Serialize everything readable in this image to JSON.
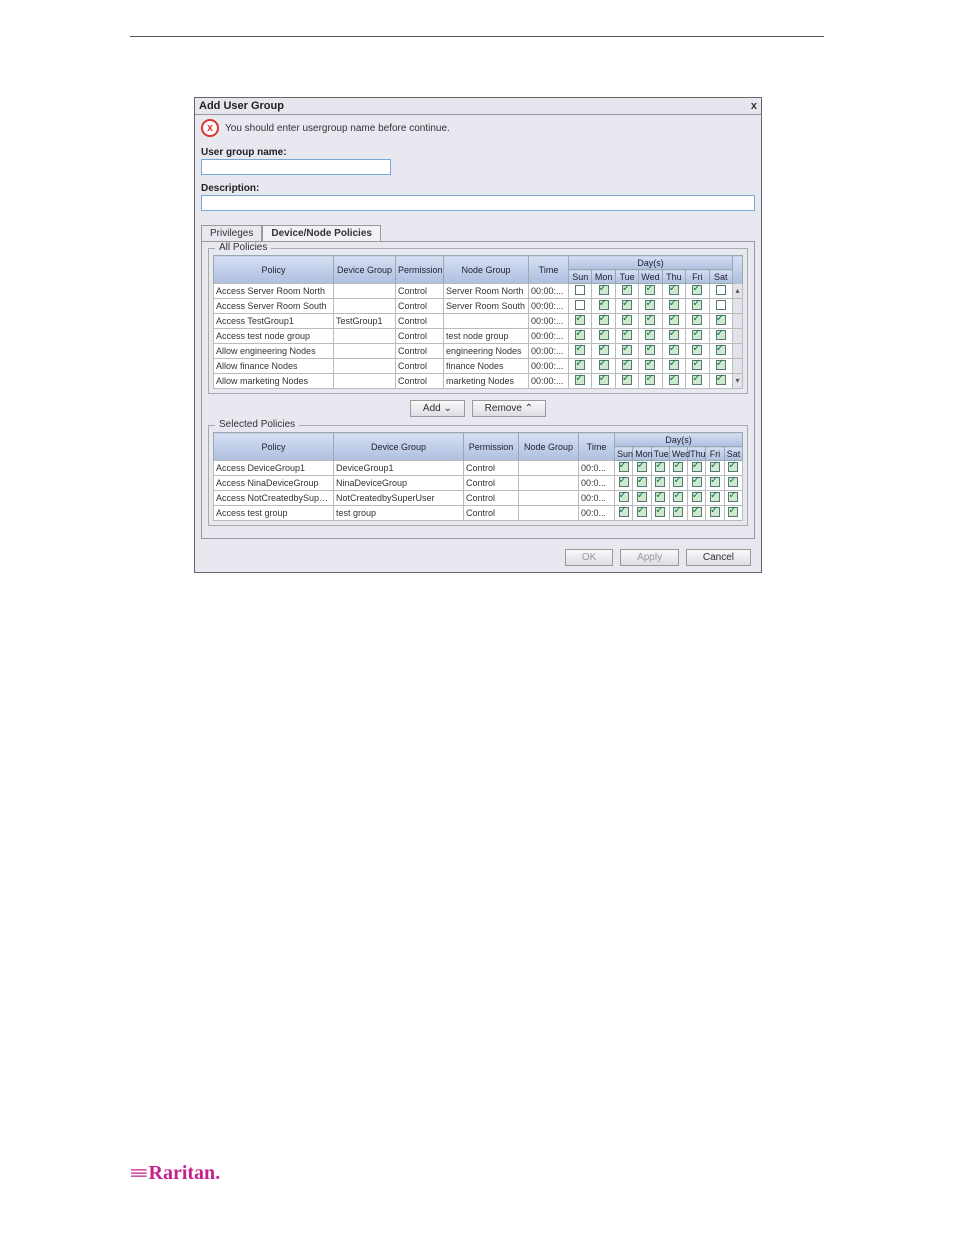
{
  "dialog": {
    "title": "Add User Group",
    "close": "x",
    "alert": "You should enter usergroup name before continue.",
    "groupNameLabel": "User group name:",
    "descriptionLabel": "Description:"
  },
  "tabs": {
    "privileges": "Privileges",
    "policies": "Device/Node Policies"
  },
  "fieldsets": {
    "all": "All Policies",
    "selected": "Selected Policies"
  },
  "headers": {
    "policy": "Policy",
    "deviceGroup": "Device Group",
    "permission": "Permission",
    "nodeGroup": "Node Group",
    "time": "Time",
    "days": "Day(s)",
    "sun": "Sun",
    "mon": "Mon",
    "tue": "Tue",
    "wed": "Wed",
    "thu": "Thu",
    "fri": "Fri",
    "sat": "Sat"
  },
  "buttons": {
    "add": "Add ⌄",
    "remove": "Remove ⌃",
    "ok": "OK",
    "apply": "Apply",
    "cancel": "Cancel"
  },
  "allPolicies": [
    {
      "policy": "Access Server Room North",
      "dg": "",
      "perm": "Control",
      "ng": "Server Room North",
      "time": "00:00:...",
      "days": [
        0,
        1,
        1,
        1,
        1,
        1,
        0
      ]
    },
    {
      "policy": "Access Server Room South",
      "dg": "",
      "perm": "Control",
      "ng": "Server Room South",
      "time": "00:00:...",
      "days": [
        0,
        1,
        1,
        1,
        1,
        1,
        0
      ]
    },
    {
      "policy": "Access TestGroup1",
      "dg": "TestGroup1",
      "perm": "Control",
      "ng": "",
      "time": "00:00:...",
      "days": [
        1,
        1,
        1,
        1,
        1,
        1,
        1
      ]
    },
    {
      "policy": "Access test node group",
      "dg": "",
      "perm": "Control",
      "ng": "test node group",
      "time": "00:00:...",
      "days": [
        1,
        1,
        1,
        1,
        1,
        1,
        1
      ]
    },
    {
      "policy": "Allow engineering Nodes",
      "dg": "",
      "perm": "Control",
      "ng": "engineering Nodes",
      "time": "00:00:...",
      "days": [
        1,
        1,
        1,
        1,
        1,
        1,
        1
      ]
    },
    {
      "policy": "Allow finance Nodes",
      "dg": "",
      "perm": "Control",
      "ng": "finance Nodes",
      "time": "00:00:...",
      "days": [
        1,
        1,
        1,
        1,
        1,
        1,
        1
      ]
    },
    {
      "policy": "Allow marketing Nodes",
      "dg": "",
      "perm": "Control",
      "ng": "marketing Nodes",
      "time": "00:00:...",
      "days": [
        1,
        1,
        1,
        1,
        1,
        1,
        1
      ]
    }
  ],
  "selectedPolicies": [
    {
      "policy": "Access DeviceGroup1",
      "dg": "DeviceGroup1",
      "perm": "Control",
      "ng": "",
      "time": "00:0...",
      "days": [
        1,
        1,
        1,
        1,
        1,
        1,
        1
      ]
    },
    {
      "policy": "Access NinaDeviceGroup",
      "dg": "NinaDeviceGroup",
      "perm": "Control",
      "ng": "",
      "time": "00:0...",
      "days": [
        1,
        1,
        1,
        1,
        1,
        1,
        1
      ]
    },
    {
      "policy": "Access NotCreatedbySupe...",
      "dg": "NotCreatedbySuperUser",
      "perm": "Control",
      "ng": "",
      "time": "00:0...",
      "days": [
        1,
        1,
        1,
        1,
        1,
        1,
        1
      ]
    },
    {
      "policy": "Access test group",
      "dg": "test group",
      "perm": "Control",
      "ng": "",
      "time": "00:0...",
      "days": [
        1,
        1,
        1,
        1,
        1,
        1,
        1
      ]
    }
  ],
  "logo": "Raritan"
}
